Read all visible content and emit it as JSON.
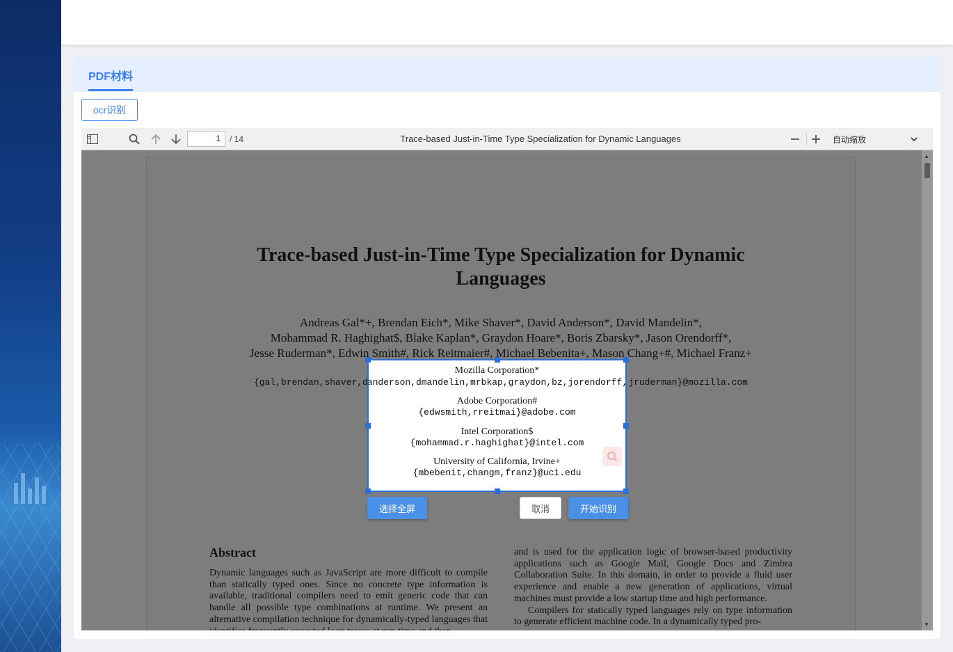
{
  "tabs": {
    "active_label": "PDF材料"
  },
  "actions": {
    "ocr_label": "ocr识别"
  },
  "viewer": {
    "page_current": "1",
    "page_total": "/ 14",
    "doc_title": "Trace-based Just-in-Time Type Specialization for Dynamic Languages",
    "zoom": "自动缩放",
    "icons": [
      "sidebar-toggle-icon",
      "search-icon",
      "arrow-up-icon",
      "arrow-down-icon",
      "zoom-out-icon",
      "zoom-in-icon",
      "chevron-down-icon"
    ]
  },
  "pdf": {
    "title_line1": "Trace-based Just-in-Time Type Specialization for Dynamic",
    "title_line2": "Languages",
    "authors_line1": "Andreas Gal*+, Brendan Eich*, Mike Shaver*, David Anderson*, David Mandelin*,",
    "authors_line2": "Mohammad R. Haghighat$, Blake Kaplan*, Graydon Hoare*, Boris Zbarsky*, Jason Orendorff*,",
    "authors_line3": "Jesse Ruderman*, Edwin Smith#, Rick Reitmaier#, Michael Bebenita+, Mason Chang+#, Michael Franz+",
    "emails": "{gal,brendan,shaver,danderson,dmandelin,mrbkap,graydon,bz,jorendorff,jruderman}@mozilla.com",
    "abstract_heading": "Abstract",
    "abstract_text": "Dynamic languages such as JavaScript are more difficult to compile than statically typed ones. Since no concrete type information is available, traditional compilers need to emit generic code that can handle all possible type combinations at runtime. We present an alternative compilation technique for dynamically-typed languages that identifies frequently executed loop traces at run-time and then",
    "right_col_text_1": "and is used for the application logic of browser-based productivity applications such as Google Mail, Google Docs and Zimbra Collaboration Suite. In this domain, in order to provide a fluid user experience and enable a new generation of applications, virtual machines must provide a low startup time and high performance.",
    "right_col_text_2": "Compilers for statically typed languages rely on type information to generate efficient machine code. In a dynamically typed pro-"
  },
  "crop": {
    "org1": "Mozilla Corporation*",
    "mail1": "{gal,brendan,shaver,danderson,dmandelin,mrbkap,graydon,bz,jorendorff,jruderman}@mozilla.com",
    "org2": "Adobe Corporation#",
    "mail2": "{edwsmith,rreitmai}@adobe.com",
    "org3": "Intel Corporation$",
    "mail3": "{mohammad.r.haghighat}@intel.com",
    "org4": "University of California, Irvine+",
    "mail4": "{mbebenit,changm,franz}@uci.edu",
    "select_all_label": "选择全屏",
    "cancel_label": "取消",
    "start_label": "开始识别"
  },
  "colors": {
    "accent": "#3b82f6",
    "tab_bg": "#e6efff",
    "crop_border": "#2b6fd8"
  }
}
